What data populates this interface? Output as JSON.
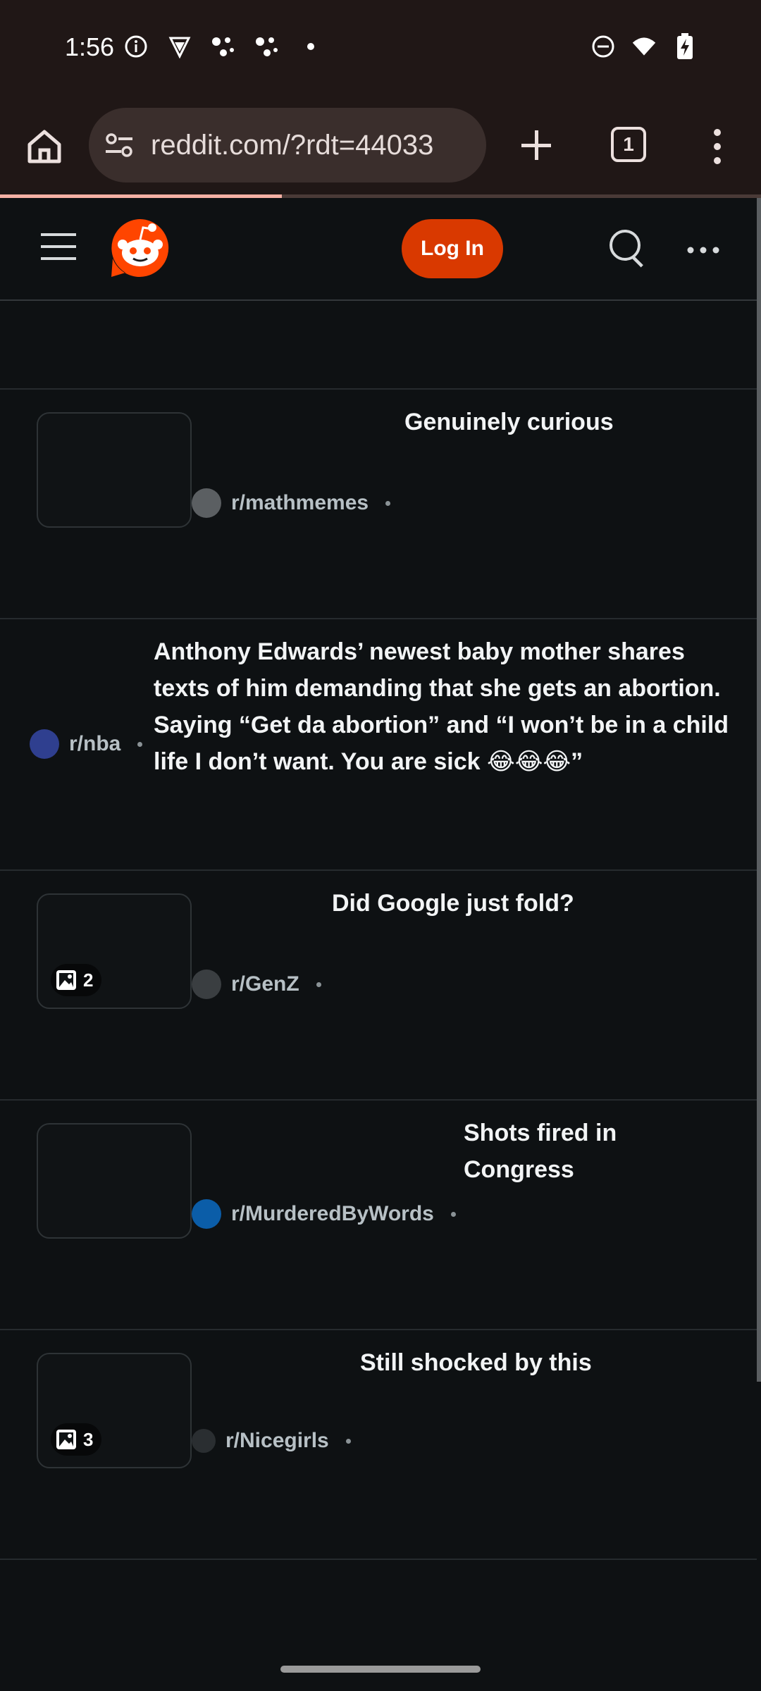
{
  "status_bar": {
    "time": "1:56",
    "left_icons": [
      "info-icon",
      "vpn-shield-icon",
      "assistant-dots-icon",
      "assistant-dots-icon",
      "notification-dot-icon"
    ],
    "right_icons": [
      "do-not-disturb-icon",
      "wifi-icon",
      "battery-charging-icon"
    ]
  },
  "browser": {
    "url": "reddit.com/?rdt=44033",
    "tab_count": "1",
    "load_progress": 0.37
  },
  "reddit_header": {
    "login_label": "Log In"
  },
  "colors": {
    "brand_orange": "#ff4500",
    "login_button": "#d93900",
    "background": "#0e1113"
  },
  "posts": [
    {
      "title": "Genuinely curious",
      "subreddit": "r/mathmemes",
      "avatar_color": "#5b5f62",
      "has_thumbnail": true,
      "gallery_count": ""
    },
    {
      "title": "Anthony Edwards’ newest baby mother shares texts of him demanding that she gets an abortion. Saying “Get da abortion” and “I won’t be in a child life I don’t want. You are sick 😂😂😂”",
      "subreddit": "r/nba",
      "avatar_color": "#2f3f8f",
      "has_thumbnail": false,
      "gallery_count": ""
    },
    {
      "title": "Did Google just fold?",
      "subreddit": "r/GenZ",
      "avatar_color": "#3a3e41",
      "has_thumbnail": true,
      "gallery_count": "2"
    },
    {
      "title": "Shots fired in Congress",
      "subreddit": "r/MurderedByWords",
      "avatar_color": "#0b5da8",
      "has_thumbnail": true,
      "gallery_count": ""
    },
    {
      "title": "Still shocked by this",
      "subreddit": "r/Nicegirls",
      "avatar_color": "#2a2e31",
      "has_thumbnail": true,
      "gallery_count": "3"
    }
  ]
}
